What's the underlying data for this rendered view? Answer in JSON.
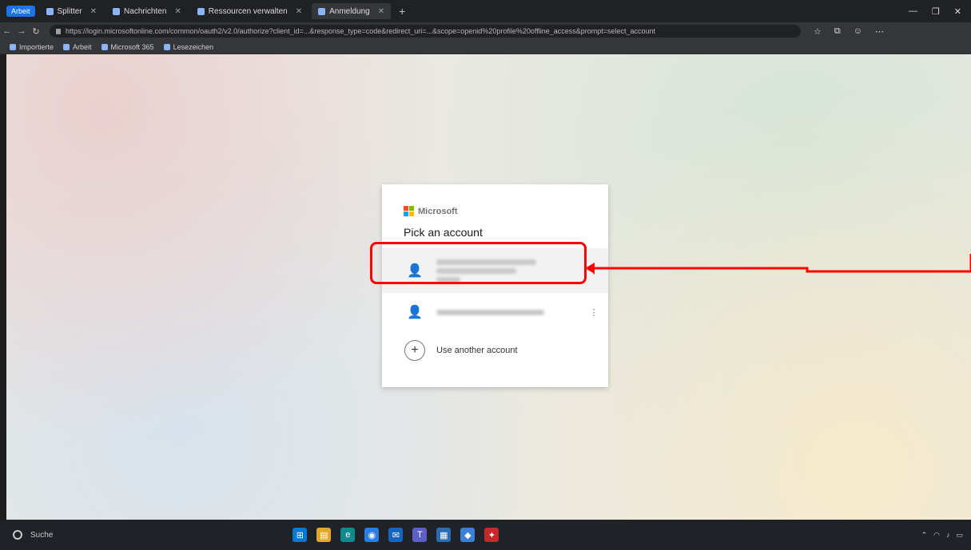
{
  "browser": {
    "workspace_label": "Arbeit",
    "tabs": [
      {
        "label": "Splitter",
        "active": false
      },
      {
        "label": "Nachrichten",
        "active": false
      },
      {
        "label": "Ressourcen verwalten",
        "active": false
      },
      {
        "label": "Anmeldung",
        "active": true
      }
    ],
    "new_tab": "+",
    "url": "https://login.microsoftonline.com/common/oauth2/v2.0/authorize?client_id=...&response_type=code&redirect_uri=...&scope=openid%20profile%20offline_access&prompt=select_account",
    "bookmarks": [
      "Importierte",
      "Arbeit",
      "Microsoft 365",
      "Lesezeichen"
    ]
  },
  "signin": {
    "brand": "Microsoft",
    "title": "Pick an account",
    "add_account": "Use another account",
    "more_options": "⋮",
    "brand_colors": [
      "#f25022",
      "#7fba00",
      "#00a4ef",
      "#ffb900"
    ]
  },
  "annotation": {
    "color": "#ff0000"
  },
  "taskbar": {
    "search": "Suche"
  }
}
